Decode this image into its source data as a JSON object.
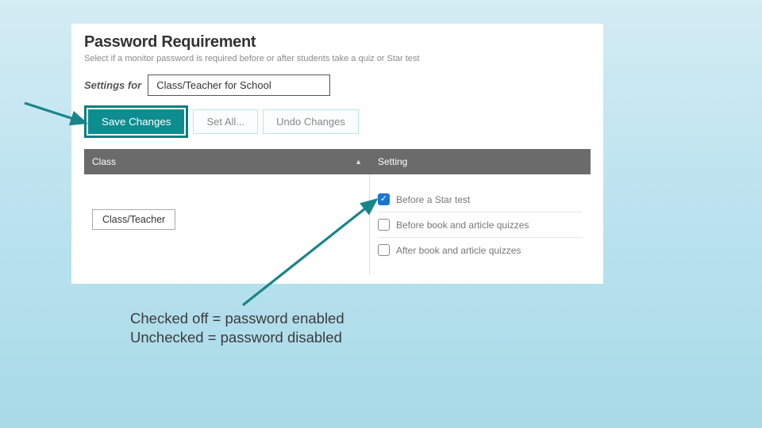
{
  "heading": "Password Requirement",
  "subheading": "Select if a monitor password is required before or after students take a quiz or Star test",
  "settings_for_label": "Settings for",
  "settings_for_value": "Class/Teacher for School",
  "buttons": {
    "save": "Save Changes",
    "set_all": "Set All...",
    "undo": "Undo Changes"
  },
  "table": {
    "header_class": "Class",
    "header_setting": "Setting",
    "row_class_label": "Class/Teacher",
    "options": {
      "star": "Before a Star test",
      "before_quiz": "Before book and article quizzes",
      "after_quiz": "After book and article quizzes"
    }
  },
  "caption_line1": "Checked off = password enabled",
  "caption_line2": "Unchecked = password disabled",
  "colors": {
    "teal": "#0d8d8f",
    "teal_dark": "#0d7d80"
  }
}
